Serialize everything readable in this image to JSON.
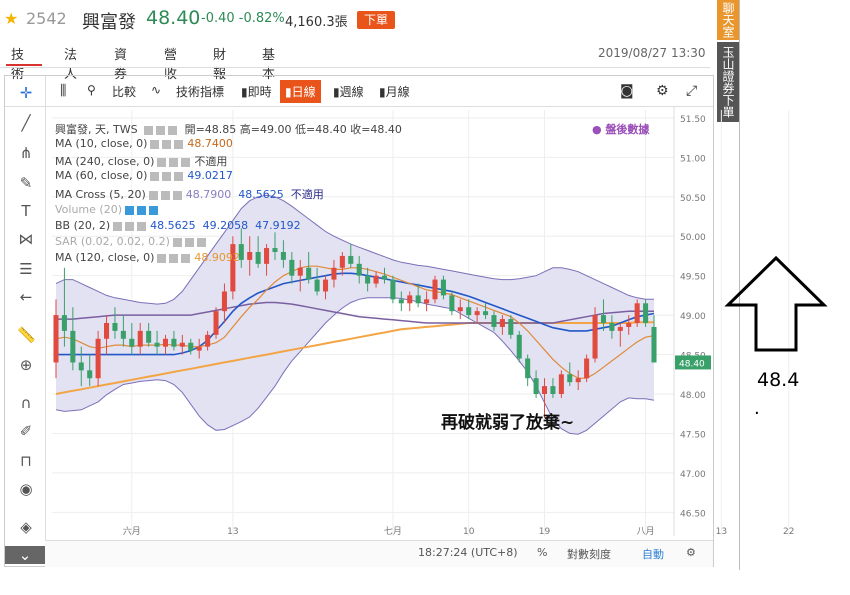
{
  "header": {
    "code": "2542",
    "name": "興富發",
    "price": "48.40",
    "change": "-0.40 -0.82%",
    "volume": "4,160.3張",
    "order_button": "下單",
    "datetime": "2019/08/27 13:30"
  },
  "tabs": [
    "技術",
    "法人",
    "資券",
    "營收",
    "財報",
    "基本"
  ],
  "side_tabs": [
    "聊天室",
    "玉山證券下單"
  ],
  "toolbar": {
    "compare": "比較",
    "indicators": "技術指標",
    "periods": [
      "即時",
      "日線",
      "週線",
      "月線"
    ],
    "active_period": "日線"
  },
  "legend": {
    "title": "興富發, 天, TWS",
    "ohlc": "開=48.85  高=49.00  低=48.40  收=48.40",
    "after_hours": "盤後數據",
    "ma10": {
      "label": "MA (10, close, 0)",
      "value": "48.7400"
    },
    "ma240": {
      "label": "MA (240, close, 0)",
      "value": "不適用"
    },
    "ma60": {
      "label": "MA (60, close, 0)",
      "value": "49.0217"
    },
    "ma_cross": {
      "label": "MA Cross (5, 20)",
      "v1": "48.7900",
      "v2": "48.5625",
      "v3": "不適用"
    },
    "volume": {
      "label": "Volume (20)"
    },
    "bb": {
      "label": "BB (20, 2)",
      "v1": "48.5625",
      "v2": "49.2058",
      "v3": "47.9192"
    },
    "sar": {
      "label": "SAR (0.02, 0.02, 0.2)"
    },
    "ma120": {
      "label": "MA (120, close, 0)",
      "value": "48.9092"
    }
  },
  "annotation": "再破就弱了放棄~",
  "right_note": {
    "value": "48.4",
    "dot": "."
  },
  "bottom_bar": {
    "time": "18:27:24 (UTC+8)",
    "percent": "%",
    "log": "對數刻度",
    "auto": "自動"
  },
  "colors": {
    "up": "#e04a3f",
    "down": "#3aa06a",
    "ma10": "#e08a3a",
    "ma60": "#2257c8",
    "ma120": "#f3a545",
    "bb": "#7b6fb8",
    "bb_fill": "#e2e2f2",
    "ma_purple": "#7a5fa0",
    "accent": "#e9541b"
  },
  "chart_data": {
    "type": "candlestick",
    "y_axis_ticks": [
      "51.50",
      "51.00",
      "50.50",
      "50.00",
      "49.50",
      "49.00",
      "48.50",
      "48.00",
      "47.50",
      "47.00",
      "46.50"
    ],
    "ylim": [
      46.2,
      51.6
    ],
    "x_axis_ticks": [
      "六月",
      "13",
      "七月",
      "10",
      "19",
      "八月",
      "13",
      "22"
    ],
    "x_tick_index": [
      9,
      21,
      40,
      49,
      58,
      70,
      79,
      87
    ],
    "last_price_label": "48.40",
    "candles": [
      [
        48.4,
        49.2,
        48.2,
        49.0
      ],
      [
        49.0,
        49.6,
        48.6,
        48.8
      ],
      [
        48.8,
        49.1,
        48.3,
        48.4
      ],
      [
        48.4,
        48.6,
        48.1,
        48.3
      ],
      [
        48.3,
        48.5,
        48.1,
        48.2
      ],
      [
        48.2,
        48.8,
        48.1,
        48.7
      ],
      [
        48.7,
        49.0,
        48.5,
        48.9
      ],
      [
        48.9,
        49.1,
        48.7,
        48.8
      ],
      [
        48.8,
        49.0,
        48.6,
        48.7
      ],
      [
        48.7,
        48.9,
        48.5,
        48.6
      ],
      [
        48.6,
        48.9,
        48.5,
        48.8
      ],
      [
        48.8,
        48.9,
        48.6,
        48.65
      ],
      [
        48.65,
        48.8,
        48.5,
        48.6
      ],
      [
        48.6,
        48.75,
        48.5,
        48.7
      ],
      [
        48.7,
        48.8,
        48.55,
        48.6
      ],
      [
        48.6,
        48.75,
        48.5,
        48.65
      ],
      [
        48.65,
        48.7,
        48.5,
        48.55
      ],
      [
        48.55,
        48.7,
        48.45,
        48.6
      ],
      [
        48.6,
        48.8,
        48.55,
        48.75
      ],
      [
        48.75,
        49.1,
        48.7,
        49.05
      ],
      [
        49.05,
        49.4,
        48.9,
        49.3
      ],
      [
        49.3,
        50.0,
        49.2,
        49.9
      ],
      [
        49.9,
        50.1,
        49.6,
        49.7
      ],
      [
        49.7,
        50.0,
        49.5,
        49.8
      ],
      [
        49.8,
        50.0,
        49.6,
        49.65
      ],
      [
        49.65,
        49.9,
        49.5,
        49.85
      ],
      [
        49.85,
        50.05,
        49.7,
        49.8
      ],
      [
        49.8,
        49.95,
        49.6,
        49.7
      ],
      [
        49.7,
        49.8,
        49.4,
        49.5
      ],
      [
        49.5,
        49.7,
        49.3,
        49.6
      ],
      [
        49.6,
        49.8,
        49.4,
        49.45
      ],
      [
        49.45,
        49.6,
        49.25,
        49.3
      ],
      [
        49.3,
        49.5,
        49.2,
        49.45
      ],
      [
        49.45,
        49.7,
        49.35,
        49.6
      ],
      [
        49.6,
        49.8,
        49.5,
        49.75
      ],
      [
        49.75,
        49.9,
        49.6,
        49.65
      ],
      [
        49.65,
        49.75,
        49.4,
        49.5
      ],
      [
        49.5,
        49.6,
        49.3,
        49.4
      ],
      [
        49.4,
        49.55,
        49.35,
        49.5
      ],
      [
        49.5,
        49.6,
        49.4,
        49.45
      ],
      [
        49.45,
        49.5,
        49.15,
        49.2
      ],
      [
        49.2,
        49.3,
        49.05,
        49.15
      ],
      [
        49.15,
        49.3,
        49.05,
        49.25
      ],
      [
        49.25,
        49.4,
        49.1,
        49.15
      ],
      [
        49.15,
        49.3,
        49.05,
        49.2
      ],
      [
        49.2,
        49.5,
        49.15,
        49.45
      ],
      [
        49.45,
        49.5,
        49.2,
        49.25
      ],
      [
        49.25,
        49.3,
        49.0,
        49.05
      ],
      [
        49.05,
        49.2,
        48.95,
        49.1
      ],
      [
        49.1,
        49.2,
        48.95,
        49.0
      ],
      [
        49.0,
        49.1,
        48.9,
        49.05
      ],
      [
        49.05,
        49.15,
        48.95,
        49.0
      ],
      [
        49.0,
        49.05,
        48.8,
        48.85
      ],
      [
        48.85,
        49.0,
        48.75,
        48.95
      ],
      [
        48.95,
        49.0,
        48.7,
        48.75
      ],
      [
        48.75,
        48.8,
        48.4,
        48.45
      ],
      [
        48.45,
        48.5,
        48.1,
        48.2
      ],
      [
        48.2,
        48.3,
        47.95,
        48.0
      ],
      [
        48.0,
        48.2,
        47.7,
        48.1
      ],
      [
        48.1,
        48.2,
        47.95,
        48.0
      ],
      [
        48.0,
        48.3,
        47.95,
        48.25
      ],
      [
        48.25,
        48.4,
        48.1,
        48.15
      ],
      [
        48.15,
        48.3,
        48.05,
        48.2
      ],
      [
        48.2,
        48.5,
        48.15,
        48.45
      ],
      [
        48.45,
        49.1,
        48.4,
        49.0
      ],
      [
        49.0,
        49.2,
        48.8,
        48.9
      ],
      [
        48.9,
        49.0,
        48.7,
        48.8
      ],
      [
        48.8,
        48.9,
        48.6,
        48.85
      ],
      [
        48.85,
        49.0,
        48.75,
        48.9
      ],
      [
        48.9,
        49.2,
        48.85,
        49.15
      ],
      [
        49.15,
        49.2,
        48.85,
        48.9
      ],
      [
        48.85,
        49.0,
        48.4,
        48.4
      ]
    ],
    "ma10": [
      48.7,
      48.72,
      48.7,
      48.65,
      48.6,
      48.58,
      48.6,
      48.62,
      48.62,
      48.6,
      48.62,
      48.62,
      48.62,
      48.63,
      48.62,
      48.62,
      48.6,
      48.6,
      48.62,
      48.65,
      48.72,
      48.85,
      48.98,
      49.1,
      49.2,
      49.32,
      49.42,
      49.5,
      49.55,
      49.6,
      49.62,
      49.62,
      49.6,
      49.58,
      49.58,
      49.6,
      49.6,
      49.58,
      49.55,
      49.52,
      49.48,
      49.44,
      49.4,
      49.36,
      49.32,
      49.3,
      49.28,
      49.26,
      49.22,
      49.18,
      49.14,
      49.1,
      49.06,
      49.02,
      48.98,
      48.9,
      48.8,
      48.68,
      48.56,
      48.44,
      48.34,
      48.26,
      48.2,
      48.2,
      48.26,
      48.34,
      48.42,
      48.5,
      48.58,
      48.66,
      48.72,
      48.74
    ],
    "ma60": [
      48.5,
      48.5,
      48.5,
      48.5,
      48.5,
      48.5,
      48.5,
      48.5,
      48.5,
      48.5,
      48.5,
      48.5,
      48.5,
      48.5,
      48.5,
      48.52,
      48.55,
      48.6,
      48.68,
      48.8,
      48.92,
      49.05,
      49.15,
      49.22,
      49.28,
      49.32,
      49.36,
      49.4,
      49.42,
      49.44,
      49.46,
      49.48,
      49.5,
      49.52,
      49.53,
      49.53,
      49.52,
      49.5,
      49.48,
      49.46,
      49.44,
      49.42,
      49.4,
      49.38,
      49.36,
      49.34,
      49.32,
      49.3,
      49.27,
      49.24,
      49.2,
      49.16,
      49.12,
      49.08,
      49.04,
      49.0,
      48.96,
      48.92,
      48.88,
      48.84,
      48.82,
      48.8,
      48.8,
      48.8,
      48.82,
      48.84,
      48.86,
      48.9,
      48.94,
      48.98,
      49.0,
      49.02
    ],
    "ma120": [
      48.0,
      48.02,
      48.04,
      48.06,
      48.08,
      48.1,
      48.12,
      48.14,
      48.16,
      48.18,
      48.2,
      48.22,
      48.24,
      48.26,
      48.28,
      48.3,
      48.32,
      48.34,
      48.36,
      48.38,
      48.4,
      48.42,
      48.44,
      48.46,
      48.48,
      48.5,
      48.52,
      48.54,
      48.56,
      48.58,
      48.6,
      48.62,
      48.64,
      48.66,
      48.68,
      48.7,
      48.72,
      48.74,
      48.76,
      48.78,
      48.8,
      48.82,
      48.83,
      48.84,
      48.85,
      48.86,
      48.87,
      48.88,
      48.89,
      48.9,
      48.9,
      48.9,
      48.9,
      48.9,
      48.9,
      48.9,
      48.9,
      48.9,
      48.9,
      48.9,
      48.9,
      48.9,
      48.9,
      48.9,
      48.9,
      48.9,
      48.9,
      48.9,
      48.9,
      48.91,
      48.91,
      48.91
    ],
    "bb_mid": [
      48.6,
      48.62,
      48.62,
      48.6,
      48.6,
      48.6,
      48.62,
      48.64,
      48.66,
      48.66,
      48.66,
      48.66,
      48.66,
      48.66,
      48.66,
      48.66,
      48.66,
      48.66,
      48.68,
      48.72,
      48.8,
      48.9,
      49.0,
      49.08,
      49.16,
      49.24,
      49.3,
      49.36,
      49.4,
      49.42,
      49.44,
      49.46,
      49.48,
      49.5,
      49.52,
      49.53,
      49.53,
      49.52,
      49.5,
      49.48,
      49.46,
      49.44,
      49.42,
      49.4,
      49.38,
      49.36,
      49.34,
      49.32,
      49.28,
      49.24,
      49.2,
      49.16,
      49.12,
      49.06,
      49.0,
      48.94,
      48.88,
      48.8,
      48.72,
      48.64,
      48.58,
      48.54,
      48.52,
      48.52,
      48.54,
      48.56,
      48.58,
      48.6,
      48.6,
      48.58,
      48.57,
      48.56
    ],
    "bb_upper": [
      49.4,
      49.45,
      49.45,
      49.4,
      49.35,
      49.3,
      49.25,
      49.22,
      49.2,
      49.18,
      49.16,
      49.15,
      49.14,
      49.15,
      49.2,
      49.3,
      49.45,
      49.6,
      49.75,
      49.9,
      50.05,
      50.2,
      50.35,
      50.45,
      50.5,
      50.52,
      50.5,
      50.45,
      50.38,
      50.3,
      50.22,
      50.14,
      50.06,
      50.0,
      49.95,
      49.9,
      49.86,
      49.82,
      49.78,
      49.74,
      49.7,
      49.67,
      49.65,
      49.63,
      49.62,
      49.6,
      49.58,
      49.56,
      49.54,
      49.52,
      49.5,
      49.48,
      49.46,
      49.45,
      49.45,
      49.46,
      49.48,
      49.5,
      49.55,
      49.6,
      49.6,
      49.58,
      49.55,
      49.5,
      49.45,
      49.4,
      49.35,
      49.3,
      49.25,
      49.22,
      49.2,
      49.2
    ],
    "bb_lower": [
      47.8,
      47.78,
      47.79,
      47.8,
      47.85,
      47.9,
      47.99,
      48.06,
      48.12,
      48.14,
      48.16,
      48.17,
      48.18,
      48.17,
      48.12,
      48.02,
      47.87,
      47.72,
      47.61,
      47.54,
      47.55,
      47.6,
      47.65,
      47.71,
      47.82,
      47.96,
      48.1,
      48.27,
      48.42,
      48.54,
      48.66,
      48.78,
      48.9,
      49.0,
      49.09,
      49.16,
      49.2,
      49.22,
      49.22,
      49.22,
      49.22,
      49.21,
      49.19,
      49.17,
      49.14,
      49.12,
      49.1,
      49.08,
      49.02,
      48.96,
      48.9,
      48.84,
      48.78,
      48.67,
      48.55,
      48.42,
      48.28,
      48.1,
      47.89,
      47.68,
      47.56,
      47.5,
      47.49,
      47.54,
      47.63,
      47.72,
      47.81,
      47.9,
      47.95,
      47.94,
      47.94,
      47.92
    ],
    "ma_purple": [
      48.95,
      48.95,
      48.95,
      48.96,
      48.97,
      48.98,
      48.99,
      49.0,
      49.0,
      49.0,
      49.0,
      49.0,
      49.0,
      49.0,
      49.0,
      49.0,
      49.0,
      49.02,
      49.04,
      49.06,
      49.08,
      49.1,
      49.12,
      49.14,
      49.15,
      49.16,
      49.16,
      49.15,
      49.14,
      49.12,
      49.1,
      49.08,
      49.06,
      49.04,
      49.02,
      49.0,
      48.98,
      48.97,
      48.96,
      48.95,
      48.94,
      48.93,
      48.92,
      48.91,
      48.9,
      48.9,
      48.9,
      48.9,
      48.9,
      48.9,
      48.9,
      48.9,
      48.9,
      48.9,
      48.9,
      48.9,
      48.9,
      48.9,
      48.9,
      48.9,
      48.92,
      48.94,
      48.96,
      48.98,
      49.0,
      49.02,
      49.03,
      49.04,
      49.05,
      49.05,
      49.05,
      49.05
    ]
  }
}
